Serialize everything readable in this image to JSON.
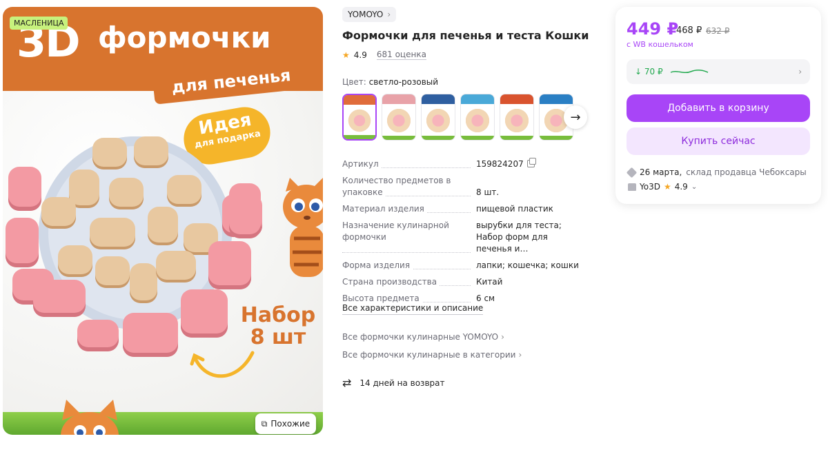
{
  "image": {
    "promo_badge": "МАСЛЕНИЦА",
    "header_3d": "3D",
    "header_word": "формочки",
    "header_sub": "для печенья",
    "idea_line1": "Идея",
    "idea_line2": "для подарка",
    "set_line1": "Набор",
    "set_line2": "8 шт",
    "similar_button": "Похожие"
  },
  "brand": {
    "name": "YOMOYO",
    "chevron": "›"
  },
  "title": "Формочки для печенья и теста Кошки",
  "rating": {
    "star": "★",
    "value": "4.9",
    "reviews": "681 оценка"
  },
  "color": {
    "label": "Цвет:",
    "value": "светло-розовый"
  },
  "swatch_colors": [
    "#e06c3b",
    "#e8a2a8",
    "#2f5fa0",
    "#4aa9d8",
    "#d9532e",
    "#2a7fc4"
  ],
  "specs": [
    {
      "key": "Артикул",
      "value": "159824207"
    },
    {
      "key": "Количество предметов в упаковке",
      "value": "8 шт."
    },
    {
      "key": "Материал изделия",
      "value": "пищевой пластик"
    },
    {
      "key": "Назначение кулинарной формочки",
      "value": "вырубки для теста; Набор форм для печенья и…"
    },
    {
      "key": "Форма изделия",
      "value": "лапки; кошечка; кошки"
    },
    {
      "key": "Страна производства",
      "value": "Китай"
    },
    {
      "key": "Высота предмета",
      "value": "6 см"
    }
  ],
  "all_specs_link": "Все характеристики и описание",
  "brand_link": "Все формочки кулинарные YOMOYO",
  "category_link": "Все формочки кулинарные в категории",
  "return_text": "14 дней на возврат",
  "price": {
    "current": "449 ₽",
    "old": "468 ₽",
    "strike": "632 ₽",
    "wallet_note": "с WB кошельком",
    "discount": "↓ 70 ₽",
    "add_to_cart": "Добавить в корзину",
    "buy_now": "Купить сейчас",
    "delivery_date": "26 марта,",
    "delivery_from": "склад продавца Чебоксары",
    "seller_name": "Yo3D",
    "seller_rating": "4.9"
  },
  "colors": {
    "accent": "#a845f7",
    "accent_light": "#f3e6fe",
    "green": "#20a84d",
    "orange": "#d8742e"
  }
}
